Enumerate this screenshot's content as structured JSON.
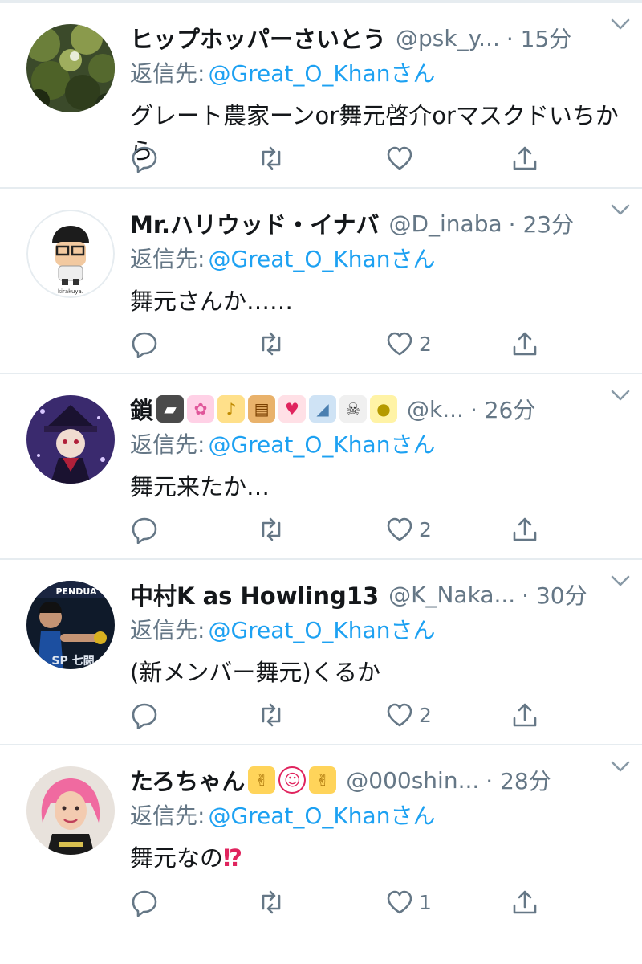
{
  "tweets": [
    {
      "name": "ヒップホッパーさいとう",
      "emojis": [],
      "handle": "@psk_y...",
      "time": "· 15分",
      "reply_prefix": "返信先:",
      "reply_target": "@Great_O_Khanさん",
      "text": "グレート農家ーンor舞元啓介orマスクドいちから",
      "likes": "",
      "avatar": "forest"
    },
    {
      "name": "Mr.ハリウッド・イナバ",
      "emojis": [],
      "handle": "@D_inaba",
      "time": "· 23分",
      "reply_prefix": "返信先:",
      "reply_target": "@Great_O_Khanさん",
      "text": "舞元さんか……",
      "likes": "2",
      "avatar": "cartoon",
      "avatar_caption": "kirakuya."
    },
    {
      "name": "鎖",
      "emojis": [
        "video-game-emoji",
        "cherry-blossom-emoji",
        "bell-emoji",
        "whisky-glass-emoji",
        "tulip-emoji",
        "shark-emoji",
        "skull-emoji",
        "lemon-emoji"
      ],
      "handle": "@k...",
      "time": "· 26分",
      "reply_prefix": "返信先:",
      "reply_target": "@Great_O_Khanさん",
      "text": "舞元来たか…",
      "likes": "2",
      "avatar": "anime-purple"
    },
    {
      "name": "中村K as Howling13",
      "emojis": [],
      "handle": "@K_Naka...",
      "time": "· 30分",
      "reply_prefix": "返信先:",
      "reply_target": "@Great_O_Khanさん",
      "text": "(新メンバー舞元)くるか",
      "likes": "2",
      "avatar": "fighter",
      "avatar_caption": "PENDUA",
      "avatar_caption2": "SP 七闘"
    },
    {
      "name": "たろちゃん",
      "emojis": [
        "sign-of-horns-emoji",
        "clown-face-emoji",
        "sign-of-horns-emoji"
      ],
      "handle": "@000shin...",
      "time": "· 28分",
      "reply_prefix": "返信先:",
      "reply_target": "@Great_O_Khanさん",
      "text": "舞元なの",
      "text_suffix": "⁉",
      "likes": "1",
      "avatar": "pink-hair"
    }
  ],
  "icons": {
    "reply": "reply-icon",
    "retweet": "retweet-icon",
    "like": "heart-icon",
    "share": "share-icon",
    "more": "chevron-down-icon"
  },
  "colors": {
    "link": "#1da1f2",
    "secondary": "#657786",
    "text": "#14171a",
    "divider": "#e6ecf0"
  }
}
